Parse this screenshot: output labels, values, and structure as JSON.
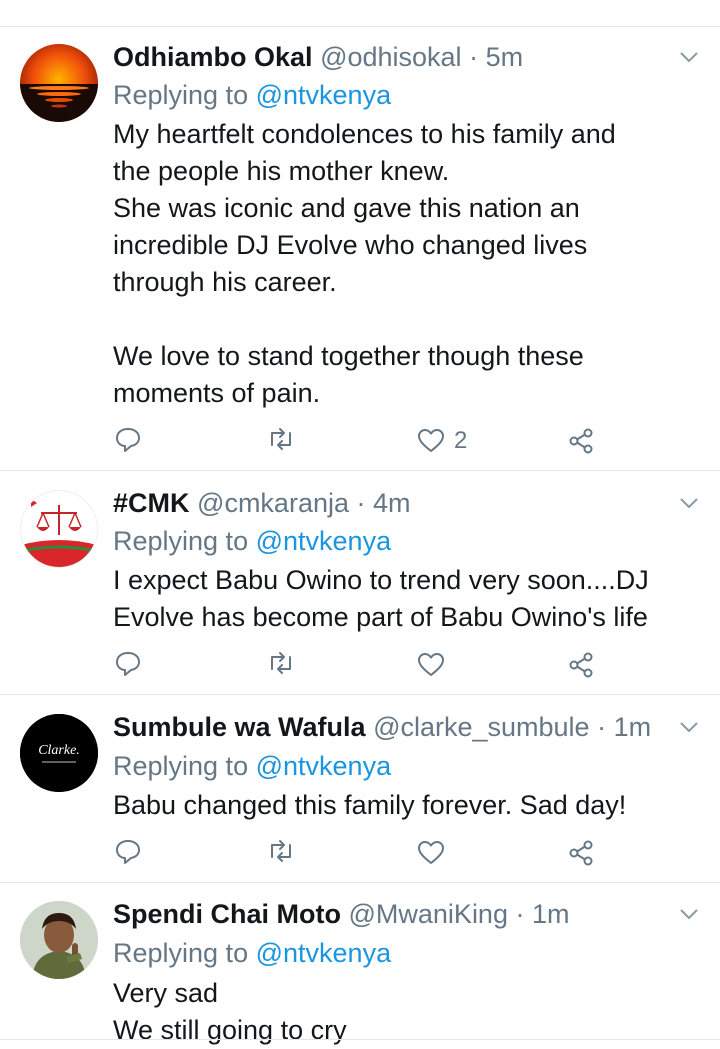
{
  "tweets": [
    {
      "name": "Odhiambo Okal",
      "handle": "@odhisokal",
      "dot": "·",
      "time": "5m",
      "reply_prefix": "Replying to",
      "reply_to": "@ntvkenya",
      "text": "My heartfelt condolences to his family and\nthe people his mother knew.\nShe was iconic and gave this nation an\nincredible DJ Evolve who changed lives\nthrough his career.\n\nWe love to stand together though these\nmoments of pain.",
      "likes": "2"
    },
    {
      "name": "#CMK",
      "handle": "@cmkaranja",
      "dot": "·",
      "time": "4m",
      "reply_prefix": "Replying to",
      "reply_to": "@ntvkenya",
      "text": "I expect Babu Owino to trend very soon....DJ\nEvolve has become part of Babu Owino's life",
      "likes": ""
    },
    {
      "name": "Sumbule wa Wafula",
      "handle": "@clarke_sumbule",
      "dot": "·",
      "time": "1m",
      "reply_prefix": "Replying to",
      "reply_to": "@ntvkenya",
      "text": "Babu changed this family forever. Sad day!",
      "likes": "",
      "avatar_text": "Clarke."
    },
    {
      "name": "Spendi Chai Moto",
      "handle": "@MwaniKing",
      "dot": "·",
      "time": "1m",
      "reply_prefix": "Replying to",
      "reply_to": "@ntvkenya",
      "text": "Very sad\nWe still going to cry",
      "likes": ""
    }
  ],
  "colors": {
    "name": "#14171a",
    "secondary": "#657786",
    "mention": "#1b95e0",
    "divider": "#e1e8ed"
  },
  "icons": [
    "chevron-down-icon",
    "reply-icon",
    "retweet-icon",
    "like-icon",
    "share-icon"
  ]
}
